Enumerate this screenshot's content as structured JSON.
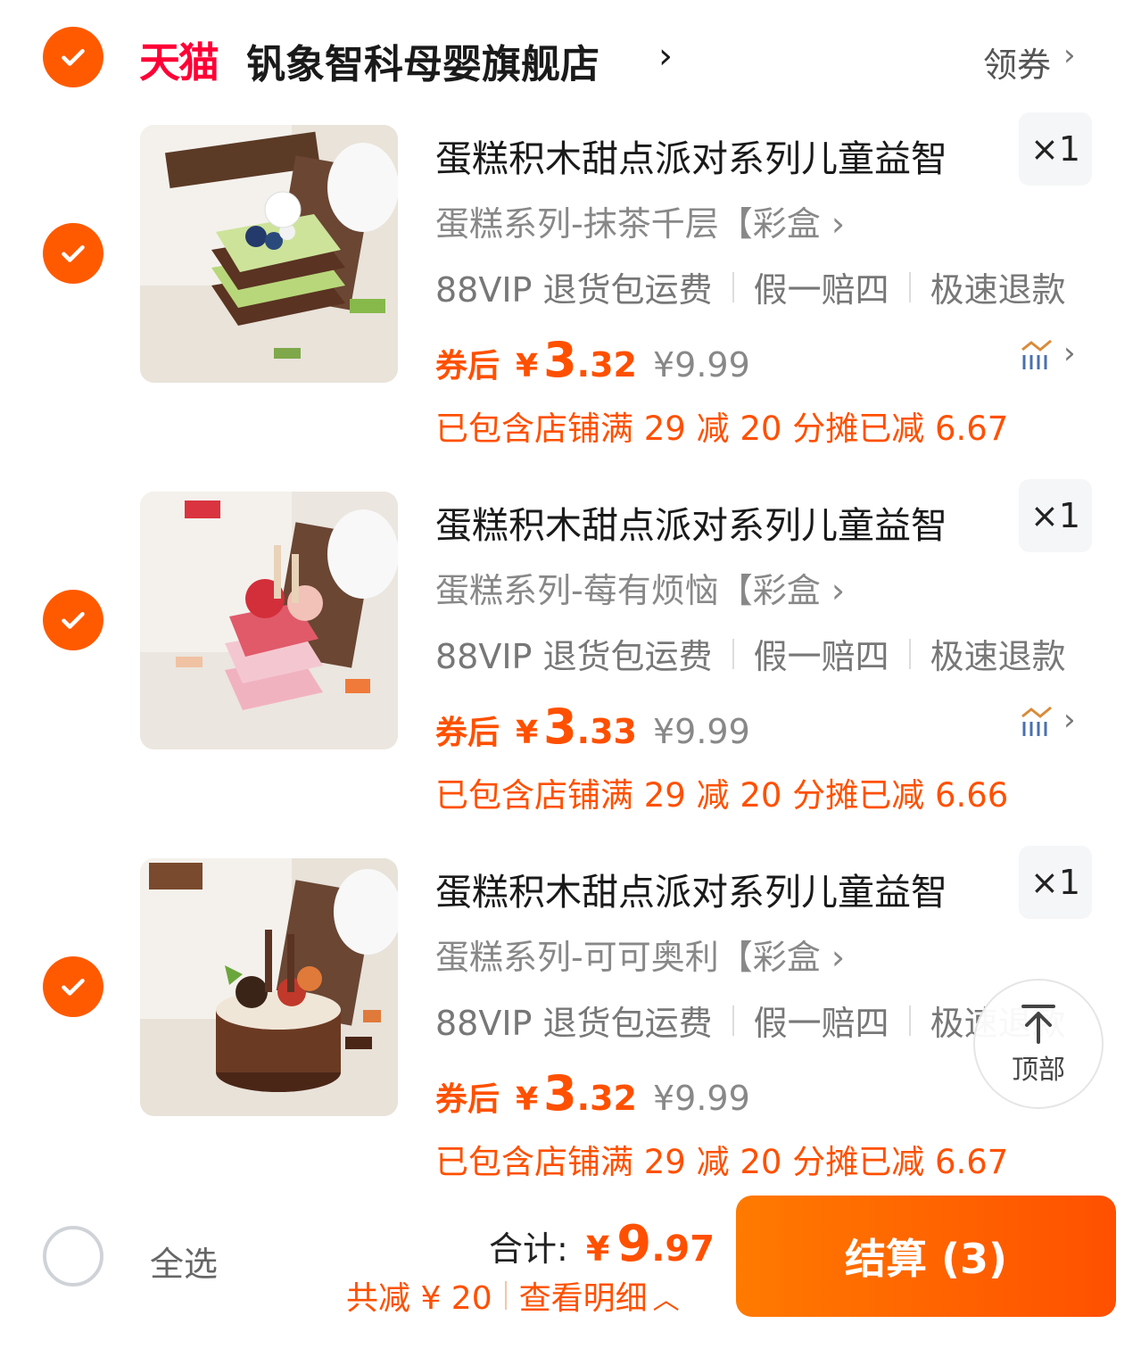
{
  "shop": {
    "platform_logo": "天猫",
    "name": "钒象智科母婴旗舰店",
    "coupon_label": "领券"
  },
  "items": [
    {
      "title": "蛋糕积木甜点派对系列儿童益智",
      "quantity": "×1",
      "sku": "蛋糕系列-抹茶千层【彩盒",
      "services": [
        "88VIP 退货包运费",
        "假一赔四",
        "极速退款"
      ],
      "price_label": "券后",
      "currency": "¥",
      "price_int": "3",
      "price_dec": ".32",
      "original_price": "¥9.99",
      "promo": "已包含店铺满 29 减 20 分摊已减 6.67",
      "checked": true
    },
    {
      "title": "蛋糕积木甜点派对系列儿童益智",
      "quantity": "×1",
      "sku": "蛋糕系列-莓有烦恼【彩盒",
      "services": [
        "88VIP 退货包运费",
        "假一赔四",
        "极速退款"
      ],
      "price_label": "券后",
      "currency": "¥",
      "price_int": "3",
      "price_dec": ".33",
      "original_price": "¥9.99",
      "promo": "已包含店铺满 29 减 20 分摊已减 6.66",
      "checked": true
    },
    {
      "title": "蛋糕积木甜点派对系列儿童益智",
      "quantity": "×1",
      "sku": "蛋糕系列-可可奥利【彩盒",
      "services": [
        "88VIP 退货包运费",
        "假一赔四",
        "极速退款"
      ],
      "price_label": "券后",
      "currency": "¥",
      "price_int": "3",
      "price_dec": ".32",
      "original_price": "¥9.99",
      "promo": "已包含店铺满 29 减 20 分摊已减 6.67",
      "checked": true
    }
  ],
  "back_to_top": {
    "label": "顶部"
  },
  "footer": {
    "select_all_label": "全选",
    "total_label": "合计:",
    "total_currency": "¥",
    "total_int": "9",
    "total_dec": ".97",
    "savings": "共减 ¥ 20",
    "detail_link": "查看明细",
    "checkout_label": "结算 (3)"
  },
  "colors": {
    "accent": "#ff5000",
    "tmall_red": "#ff0036",
    "checkout_bg": "#ff6a00"
  },
  "icons": [
    "check-icon",
    "chevron-right-icon",
    "price-trend-icon",
    "arrow-up-icon",
    "chevron-up-icon"
  ]
}
